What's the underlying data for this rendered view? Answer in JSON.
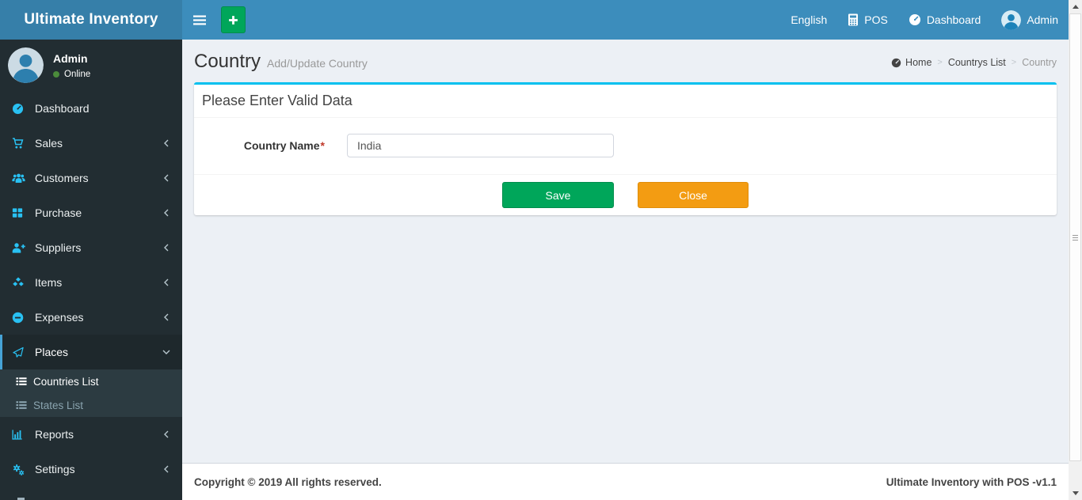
{
  "app": {
    "title": "Ultimate Inventory"
  },
  "navbar": {
    "language_label": "English",
    "pos_label": "POS",
    "dashboard_label": "Dashboard",
    "user_label": "Admin"
  },
  "user_panel": {
    "name": "Admin",
    "status": "Online"
  },
  "sidebar": {
    "items": [
      {
        "label": "Dashboard",
        "icon": "tachometer-icon",
        "expandable": false,
        "active": false
      },
      {
        "label": "Sales",
        "icon": "cart-icon",
        "expandable": true,
        "active": false
      },
      {
        "label": "Customers",
        "icon": "users-icon",
        "expandable": true,
        "active": false
      },
      {
        "label": "Purchase",
        "icon": "grid-icon",
        "expandable": true,
        "active": false
      },
      {
        "label": "Suppliers",
        "icon": "user-plus-icon",
        "expandable": true,
        "active": false
      },
      {
        "label": "Items",
        "icon": "cubes-icon",
        "expandable": true,
        "active": false
      },
      {
        "label": "Expenses",
        "icon": "minus-circle-icon",
        "expandable": true,
        "active": false
      },
      {
        "label": "Places",
        "icon": "paper-plane-icon",
        "expandable": true,
        "active": true,
        "expanded": true
      },
      {
        "label": "Reports",
        "icon": "bar-chart-icon",
        "expandable": true,
        "active": false
      },
      {
        "label": "Settings",
        "icon": "gears-icon",
        "expandable": true,
        "active": false
      }
    ],
    "places_submenu": [
      {
        "label": "Countries List",
        "icon": "list-icon",
        "active": true
      },
      {
        "label": "States List",
        "icon": "list-icon",
        "active": false
      }
    ]
  },
  "content": {
    "page_title": "Country",
    "page_subtitle": "Add/Update Country",
    "breadcrumb": [
      {
        "label": "Home",
        "icon": "tachometer-icon"
      },
      {
        "label": "Countrys List"
      },
      {
        "label": "Country"
      }
    ],
    "breadcrumb_separator": ">",
    "box": {
      "title": "Please Enter Valid Data",
      "field_label": "Country Name",
      "required_mark": "*",
      "field_value": "India",
      "save_label": "Save",
      "close_label": "Close"
    }
  },
  "footer": {
    "left": "Copyright © 2019 All rights reserved.",
    "right": "Ultimate Inventory with POS -v1.1"
  },
  "colors": {
    "navbar": "#3c8dbc",
    "logo_bg": "#367fa9",
    "sidebar_bg": "#222d32",
    "sidebar_active_bg": "#1e282c",
    "sidebar_active_border": "#46a3d6",
    "submenu_bg": "#2c3b41",
    "sidebar_icon": "#29c1f3",
    "panel_accent": "#00c0ef",
    "success": "#00a65a",
    "warning": "#f39c12",
    "online_dot": "#4b8b3b"
  }
}
